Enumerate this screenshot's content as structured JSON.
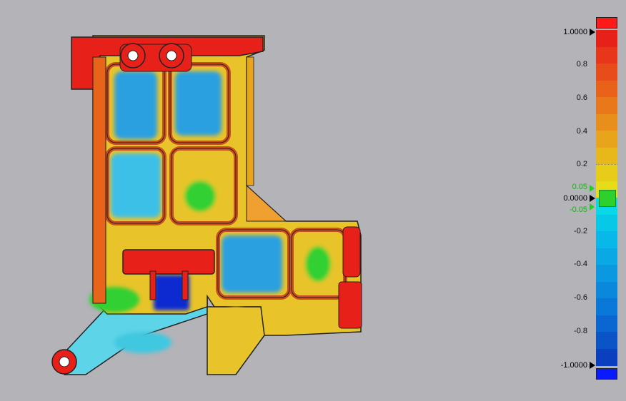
{
  "legend": {
    "max_label": "1.0000",
    "min_label": "-1.0000",
    "zero_label": "0.0000",
    "upper_tol_label": "0.05",
    "lower_tol_label": "-0.05",
    "ticks": [
      "0.8",
      "0.6",
      "0.4",
      "0.2",
      "-0.2",
      "-0.4",
      "-0.6",
      "-0.8"
    ],
    "over_color": "#ff1a1a",
    "under_color": "#0a1aff",
    "nominal_color": "#2ed02e",
    "scale_colors": [
      "#e8201a",
      "#e8361a",
      "#e84c1a",
      "#e8621a",
      "#e8781a",
      "#e88e1a",
      "#e8a41a",
      "#e8b81a",
      "#e8cc1a",
      "#e8dc1a",
      "#08d8e8",
      "#08c8e8",
      "#08b8e8",
      "#0aa8e4",
      "#0a98e0",
      "#0a88dc",
      "#0a78d8",
      "#0a66d0",
      "#0a54c8",
      "#0a40c0"
    ]
  },
  "viewport": {
    "model": "deviation color map of part",
    "background": "#b3b3b8"
  }
}
